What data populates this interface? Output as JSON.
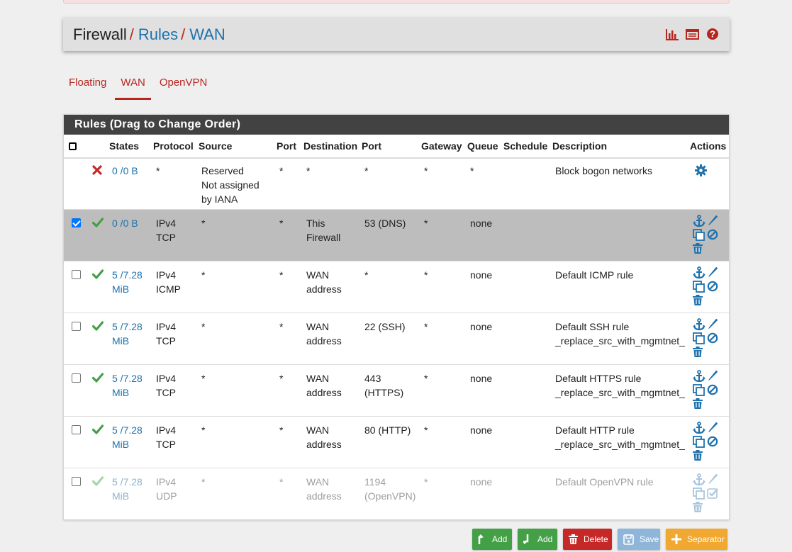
{
  "breadcrumb": {
    "root": "Firewall",
    "rules": "Rules",
    "current": "WAN",
    "separator": "/"
  },
  "title_icons": [
    "bar-chart-icon",
    "table-list-icon",
    "help-icon"
  ],
  "tabs": [
    {
      "label": "Floating",
      "active": false
    },
    {
      "label": "WAN",
      "active": true
    },
    {
      "label": "OpenVPN",
      "active": false
    }
  ],
  "panel": {
    "heading": "Rules (Drag to Change Order)",
    "columns": [
      "States",
      "Protocol",
      "Source",
      "Port",
      "Destination",
      "Port",
      "Gateway",
      "Queue",
      "Schedule",
      "Description",
      "Actions"
    ]
  },
  "rows": [
    {
      "status": "block",
      "states": "0 /0 B",
      "protocol": [
        "*"
      ],
      "source": [
        "Reserved",
        "Not assigned",
        "by IANA"
      ],
      "sport": "*",
      "destination": [
        "*"
      ],
      "dport": [
        "*"
      ],
      "gateway": "*",
      "queue": "*",
      "schedule": "",
      "description": [
        "Block bogon networks"
      ]
    },
    {
      "status": "pass",
      "states": "0 /0 B",
      "protocol": [
        "IPv4",
        "TCP"
      ],
      "source": [
        "*"
      ],
      "sport": "*",
      "destination": [
        "This",
        "Firewall"
      ],
      "dport": [
        "53 (DNS)"
      ],
      "gateway": "*",
      "queue": "none",
      "schedule": "",
      "description": [
        ""
      ],
      "checked": true
    },
    {
      "status": "pass",
      "states": "5 /7.28 MiB",
      "protocol": [
        "IPv4",
        "ICMP"
      ],
      "source": [
        "*"
      ],
      "sport": "*",
      "destination": [
        "WAN",
        "address"
      ],
      "dport": [
        "*"
      ],
      "gateway": "*",
      "queue": "none",
      "schedule": "",
      "description": [
        "Default ICMP rule"
      ]
    },
    {
      "status": "pass",
      "states": "5 /7.28 MiB",
      "protocol": [
        "IPv4",
        "TCP"
      ],
      "source": [
        "*"
      ],
      "sport": "*",
      "destination": [
        "WAN",
        "address"
      ],
      "dport": [
        "22 (SSH)"
      ],
      "gateway": "*",
      "queue": "none",
      "schedule": "",
      "description": [
        "Default SSH rule",
        "_replace_src_with_mgmtnet_"
      ]
    },
    {
      "status": "pass",
      "states": "5 /7.28 MiB",
      "protocol": [
        "IPv4",
        "TCP"
      ],
      "source": [
        "*"
      ],
      "sport": "*",
      "destination": [
        "WAN",
        "address"
      ],
      "dport": [
        "443",
        "(HTTPS)"
      ],
      "gateway": "*",
      "queue": "none",
      "schedule": "",
      "description": [
        "Default HTTPS rule",
        "_replace_src_with_mgmtnet_"
      ]
    },
    {
      "status": "pass",
      "states": "5 /7.28 MiB",
      "protocol": [
        "IPv4",
        "TCP"
      ],
      "source": [
        "*"
      ],
      "sport": "*",
      "destination": [
        "WAN",
        "address"
      ],
      "dport": [
        "80 (HTTP)"
      ],
      "gateway": "*",
      "queue": "none",
      "schedule": "",
      "description": [
        "Default HTTP rule",
        "_replace_src_with_mgmtnet_"
      ]
    },
    {
      "status": "pass-disabled",
      "states": "5 /7.28 MiB",
      "protocol": [
        "IPv4",
        "UDP"
      ],
      "source": [
        "*"
      ],
      "sport": "*",
      "destination": [
        "WAN",
        "address"
      ],
      "dport": [
        "1194",
        "(OpenVPN)"
      ],
      "gateway": "*",
      "queue": "none",
      "schedule": "",
      "description": [
        "Default OpenVPN rule"
      ],
      "disabled": true
    }
  ],
  "buttons": {
    "add_top": "Add",
    "add_bottom": "Add",
    "delete": "Delete",
    "save": "Save",
    "separator": "Separator"
  },
  "colors": {
    "link": "#1e72ad",
    "accent_red": "#b8251f",
    "heading_bg": "#424242",
    "pass_green": "#43a047",
    "block_red": "#c62828"
  }
}
